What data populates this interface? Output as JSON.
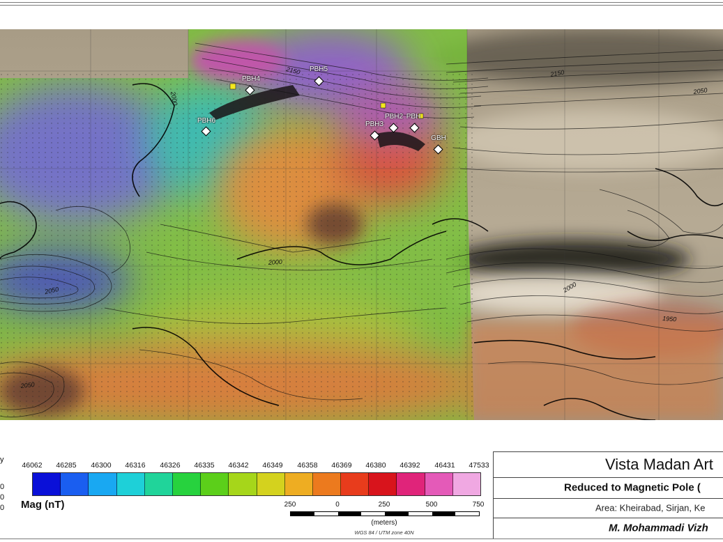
{
  "map": {
    "wells": [
      {
        "id": "PBH4",
        "label": "PBH4"
      },
      {
        "id": "PBH5",
        "label": "PBH5"
      },
      {
        "id": "PBH6",
        "label": "PBH6"
      },
      {
        "id": "PBH2",
        "label": "PBH2"
      },
      {
        "id": "PBH3",
        "label": "PBH3"
      },
      {
        "id": "PBH1",
        "label": "PBH"
      },
      {
        "id": "GBH",
        "label": "GBH"
      }
    ],
    "contour_labels": [
      "2050",
      "2150",
      "2000",
      "2050",
      "2000",
      "1950",
      "2150",
      "2050",
      "2000"
    ]
  },
  "legend": {
    "tick_values": [
      "46062",
      "46285",
      "46300",
      "46316",
      "46326",
      "46335",
      "46342",
      "46349",
      "46358",
      "46369",
      "46380",
      "46392",
      "46431",
      "47533"
    ],
    "colors": [
      "#0a10d8",
      "#1a5ef0",
      "#19a8f2",
      "#1ed0d8",
      "#20d49a",
      "#27d23e",
      "#5ccf1a",
      "#a6d61a",
      "#d4d21e",
      "#eead22",
      "#ec7a1e",
      "#e83c1c",
      "#d8141c",
      "#e0247a",
      "#e45ab8",
      "#f0a8e2"
    ],
    "label": "Mag (nT)",
    "scale": {
      "numbers": [
        "250",
        "0",
        "250",
        "500",
        "750"
      ],
      "unit": "(meters)",
      "projection": "WGS 84 / UTM zone 40N"
    },
    "left_edge": [
      "y",
      "0",
      "0",
      "0"
    ]
  },
  "title_block": {
    "company": "Vista Madan Art",
    "map_title": "Reduced to Magnetic Pole (",
    "area": "Area: Kheirabad, Sirjan, Ke",
    "author": "M. Mohammadi Vizh"
  }
}
